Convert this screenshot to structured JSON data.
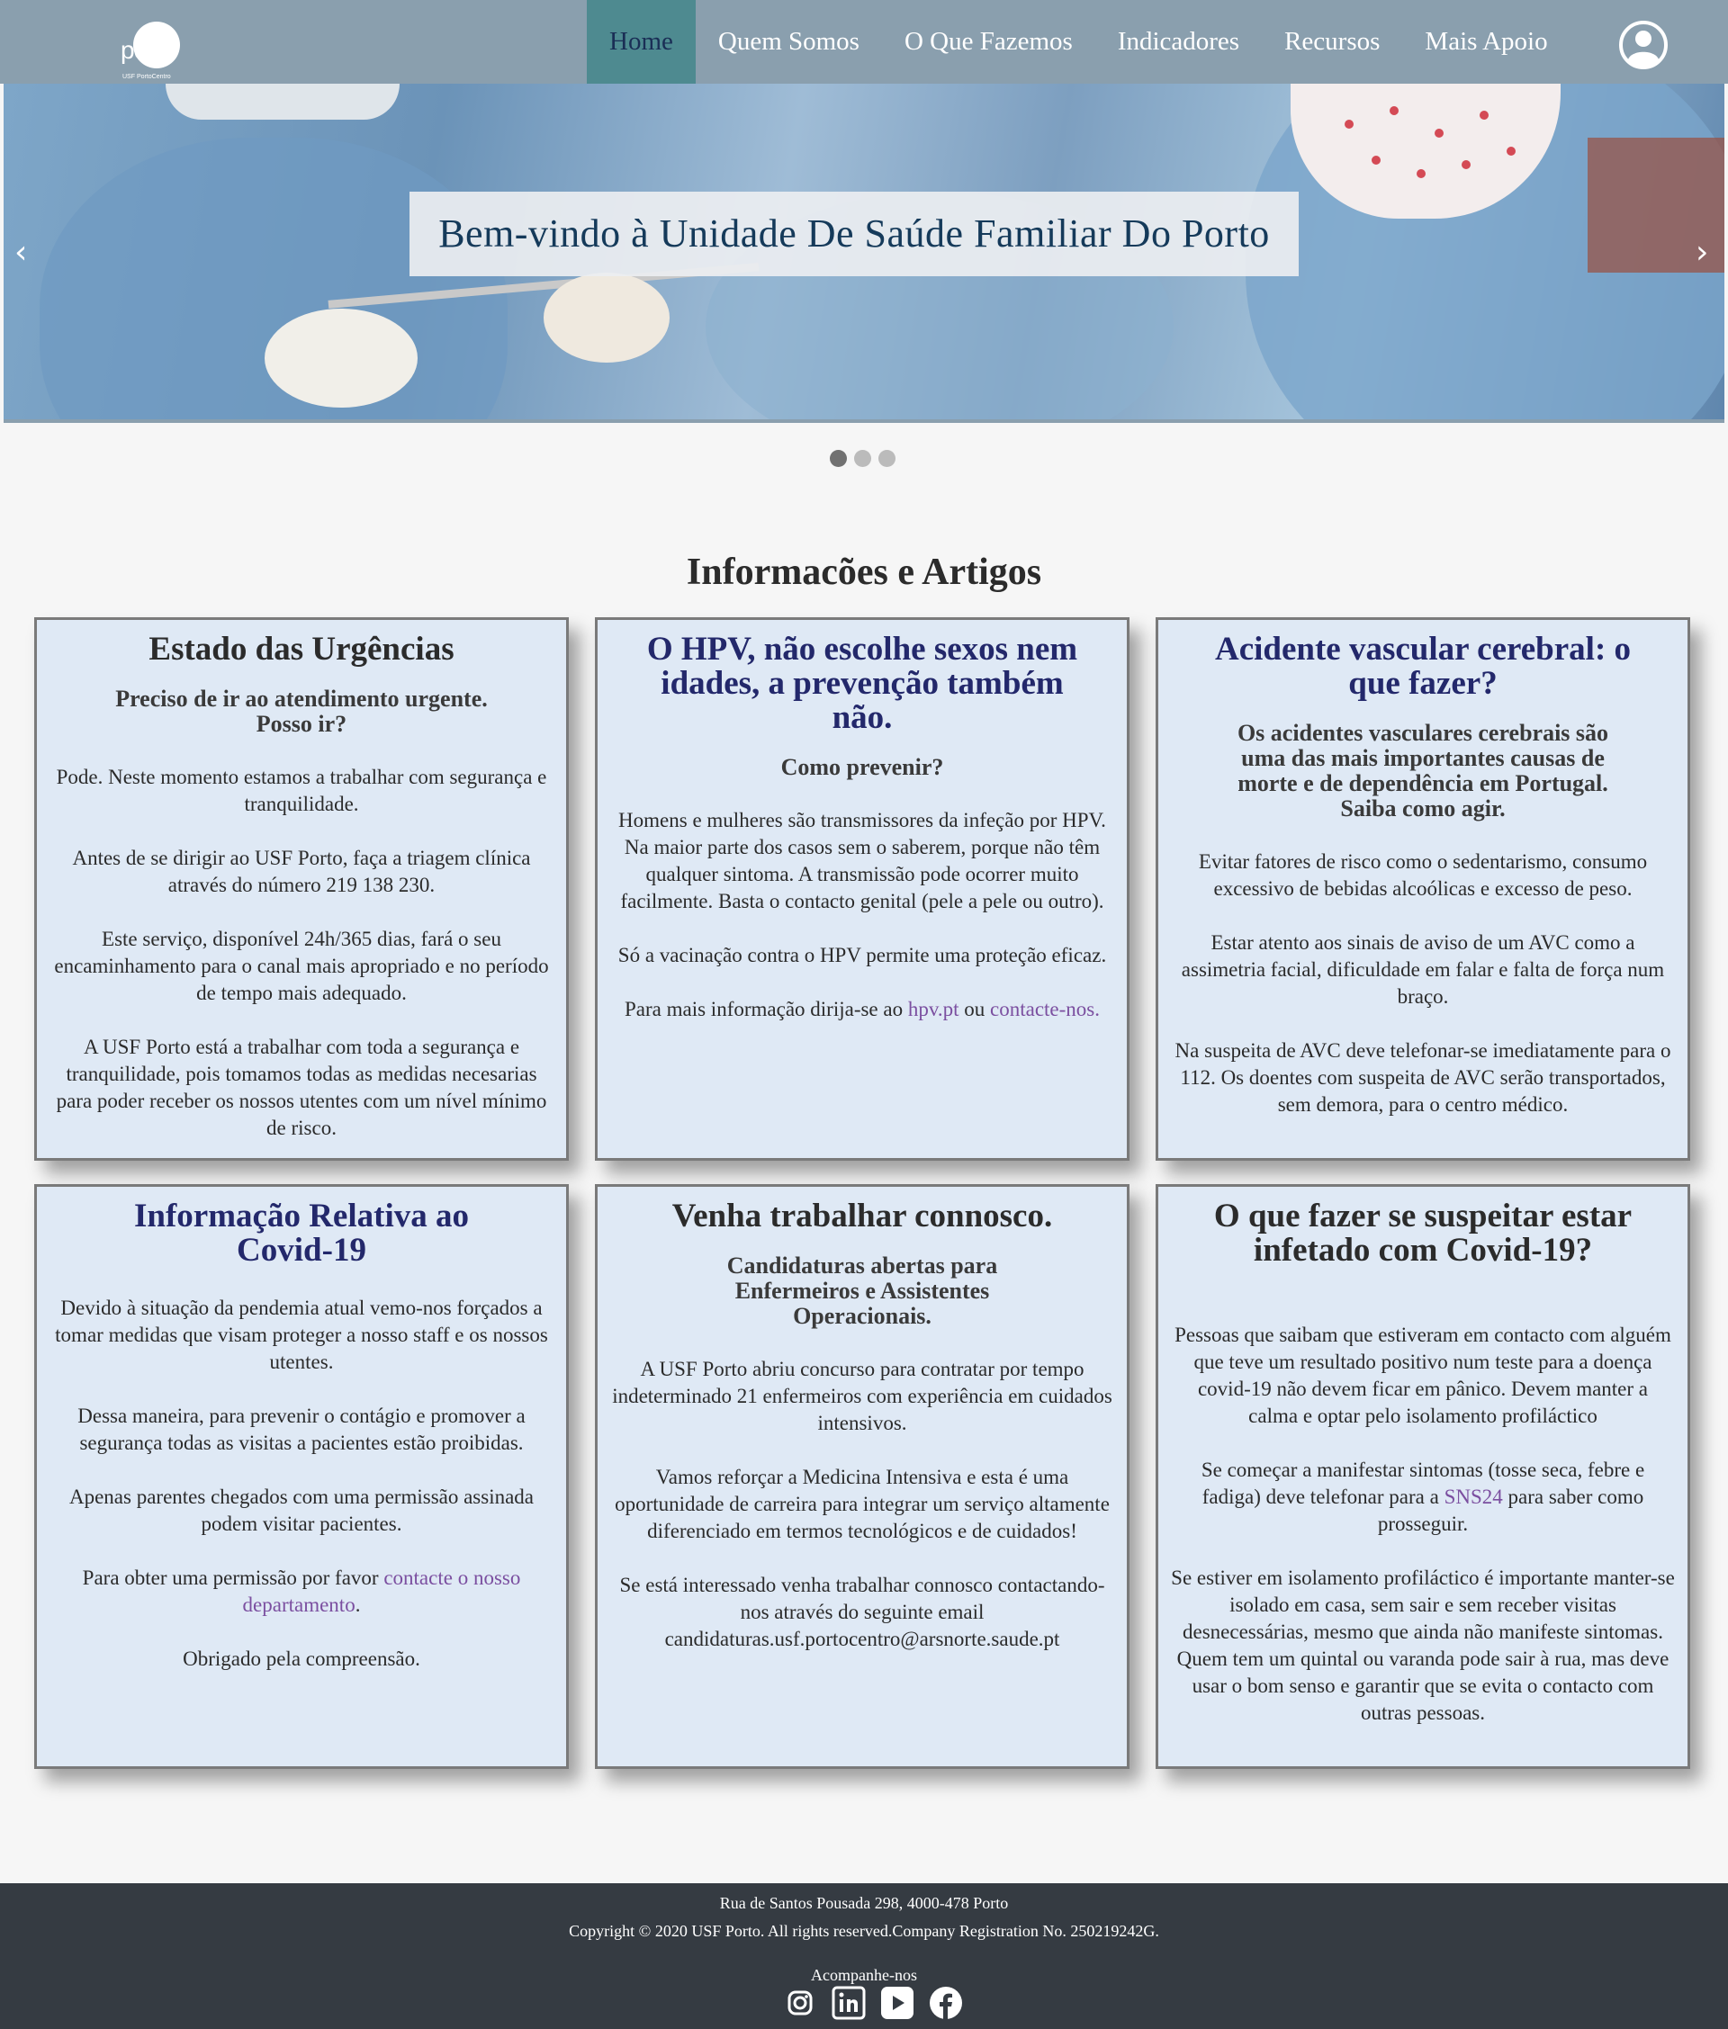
{
  "nav": {
    "logo_text": "pc",
    "logo_sub": "USF PortoCentro",
    "items": [
      {
        "label": "Home",
        "active": true
      },
      {
        "label": "Quem Somos"
      },
      {
        "label": "O Que Fazemos"
      },
      {
        "label": "Indicadores"
      },
      {
        "label": "Recursos"
      },
      {
        "label": "Mais Apoio"
      }
    ],
    "user_icon": "user-circle-icon"
  },
  "hero": {
    "caption": "Bem-vindo à Unidade De Saúde Familiar Do Porto",
    "prev": "‹",
    "next": "›",
    "slides": 3,
    "active_slide": 1
  },
  "section": {
    "title": "Informacões e Artigos"
  },
  "cards": [
    {
      "title": "Estado das Urgências",
      "subtitle": "Preciso de ir ao atendimento urgente. Posso ir?",
      "p1": "Pode. Neste momento estamos a trabalhar com segurança e tranquilidade.",
      "p2": "Antes de se dirigir ao USF Porto, faça a triagem clínica através do número 219 138 230.",
      "p3": "Este serviço, disponível 24h/365 dias, fará o seu encaminhamento para o canal mais apropriado e no período de tempo mais adequado.",
      "p4": "A USF Porto está a trabalhar com toda a segurança e tranquilidade, pois tomamos todas as medidas necesarias para poder receber os nossos utentes com um nível mínimo de risco."
    },
    {
      "title": "O HPV, não escolhe sexos nem idades, a prevenção também não.",
      "subtitle": "Como prevenir?",
      "p1": "Homens e mulheres são transmissores da infeção por HPV. Na maior parte dos casos sem o saberem, porque não têm qualquer sintoma. A transmissão pode ocorrer muito facilmente. Basta o contacto genital (pele a pele ou outro).",
      "p2": "Só a vacinação contra o HPV permite uma proteção eficaz.",
      "p3_pre": "Para mais informação dirija-se ao ",
      "p3_link1": "hpv.pt",
      "p3_mid": " ou ",
      "p3_link2": "contacte-nos."
    },
    {
      "title": "Acidente vascular cerebral: o que fazer?",
      "subtitle": "Os acidentes vasculares cerebrais são uma das mais importantes causas de morte e de dependência em Portugal. Saiba como agir.",
      "p1": "Evitar fatores de risco como o sedentarismo, consumo excessivo de bebidas alcoólicas e excesso de peso.",
      "p2": "Estar atento aos sinais de aviso de um AVC como a assimetria facial, dificuldade em falar e falta de força num braço.",
      "p3": "Na suspeita de AVC deve telefonar-se imediatamente para o 112. Os doentes com suspeita de AVC serão transportados, sem demora, para o centro médico."
    },
    {
      "title": "Informação Relativa ao Covid-19",
      "p1": "Devido à situação da pendemia atual vemo-nos forçados a tomar medidas que visam proteger a nosso staff e os nossos utentes.",
      "p2": "Dessa maneira, para prevenir o contágio e promover a segurança todas as visitas a pacientes estão proibidas.",
      "p3": "Apenas parentes chegados com uma permissão assinada podem visitar pacientes.",
      "p4_pre": "Para obter uma permissão por favor ",
      "p4_link": "contacte o nosso departamento",
      "p4_post": ".",
      "p5": "Obrigado pela compreensão."
    },
    {
      "title": "Venha trabalhar connosco.",
      "subtitle": "Candidaturas abertas para Enfermeiros e Assistentes Operacionais.",
      "p1": "A USF Porto abriu concurso para contratar por tempo indeterminado 21 enfermeiros com experiência em cuidados intensivos.",
      "p2": "Vamos reforçar a Medicina Intensiva e esta é uma oportunidade de carreira para integrar um serviço altamente diferenciado em termos tecnológicos e de cuidados!",
      "p3": "Se está interessado venha trabalhar connosco contactando-nos através do seguinte email candidaturas.usf.portocentro@arsnorte.saude.pt"
    },
    {
      "title": "O que fazer se suspeitar estar infetado com Covid-19?",
      "p1": "Pessoas que saibam que estiveram em contacto com alguém que teve um resultado positivo num teste para a doença covid-19 não devem ficar em pânico. Devem manter a calma e optar pelo isolamento profiláctico",
      "p2_pre": "Se começar a manifestar sintomas (tosse seca, febre e fadiga) deve telefonar para a ",
      "p2_link": "SNS24",
      "p2_post": " para saber como prosseguir.",
      "p3": "Se estiver em isolamento profiláctico é importante manter-se isolado em casa, sem sair e sem receber visitas desnecessárias, mesmo que ainda não manifeste sintomas. Quem tem um quintal ou varanda pode sair à rua, mas deve usar o bom senso e garantir que se evita o contacto com outras pessoas."
    }
  ],
  "footer": {
    "address": "Rua de Santos Pousada 298, 4000-478 Porto",
    "copyright": "Copyright © 2020 USF Porto. All rights reserved.Company Registration No. 250219242G.",
    "follow": "Acompanhe-nos",
    "socials": [
      "instagram-icon",
      "linkedin-icon",
      "youtube-icon",
      "facebook-icon"
    ]
  },
  "colors": {
    "navbar": "#8a9fae",
    "nav_active": "#4e8a90",
    "card_bg": "#dfe9f5",
    "navy_title": "#23286b",
    "link": "#7b4fa0",
    "footer": "#353b42"
  }
}
